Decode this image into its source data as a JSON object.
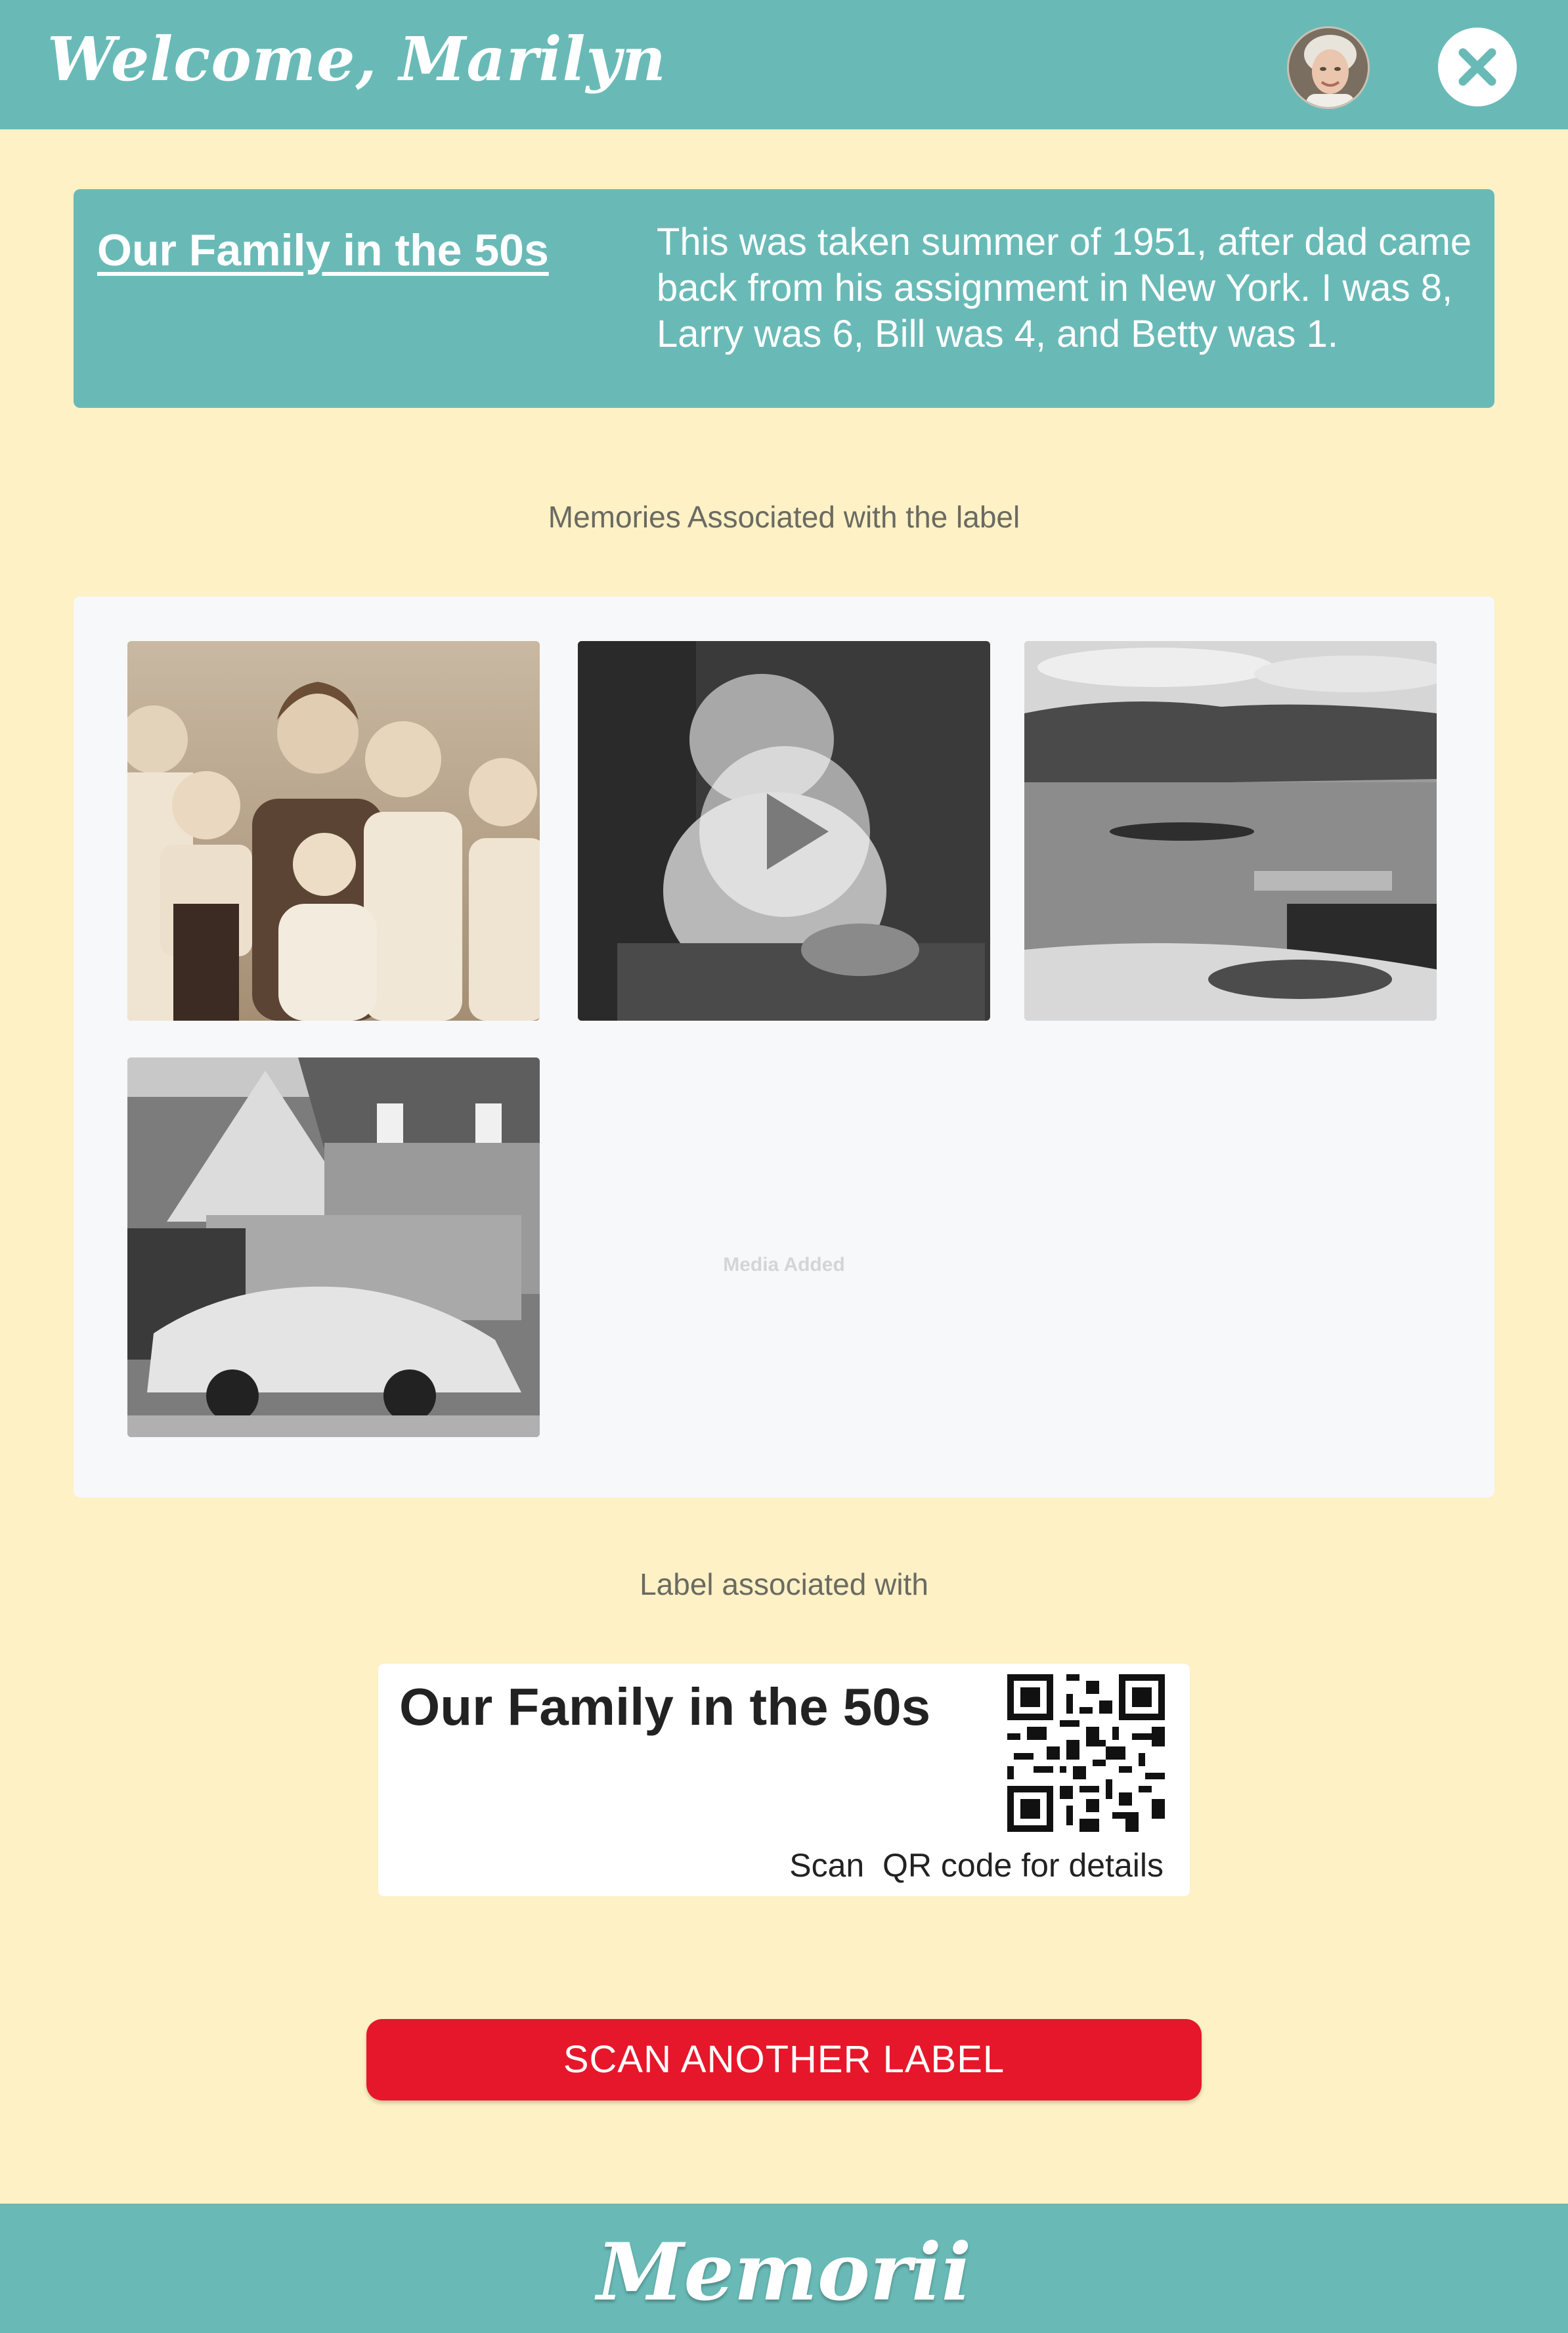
{
  "header": {
    "welcome": "Welcome, Marilyn",
    "avatar_icon": "user-avatar-photo",
    "close_icon": "close-icon"
  },
  "label": {
    "title": "Our Family in the 50s",
    "description": "This was taken summer of 1951, after dad came back from his assignment in New York. I was 8, Larry was 6, Bill was 4, and Betty was 1."
  },
  "memories": {
    "heading": "Memories Associated with the label",
    "items": [
      {
        "type": "photo",
        "subject": "sepia family portrait"
      },
      {
        "type": "video",
        "subject": "baby sitting",
        "overlay_icon": "play-icon"
      },
      {
        "type": "photo",
        "subject": "lake with canoes"
      },
      {
        "type": "photo",
        "subject": "house with vintage car"
      }
    ],
    "placeholder": "Media Added"
  },
  "label_card": {
    "heading": "Label associated with",
    "title": "Our Family in the 50s",
    "scan_text": "Scan  QR code for details",
    "qr_icon": "qr-code-icon"
  },
  "actions": {
    "scan_button": "SCAN ANOTHER LABEL"
  },
  "footer": {
    "logo": "Memorii"
  },
  "colors": {
    "background": "#fdf1c5",
    "teal": "#69bab7",
    "button_red": "#e6172a",
    "panel": "#f7f8fa"
  }
}
